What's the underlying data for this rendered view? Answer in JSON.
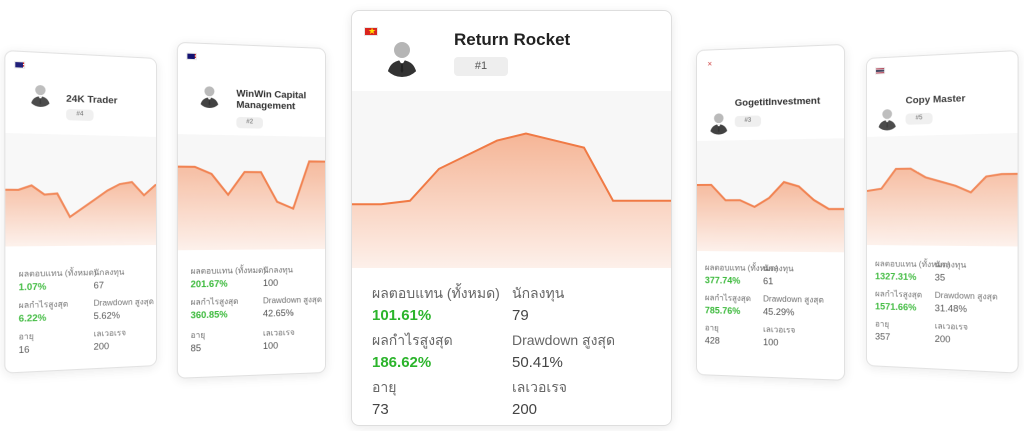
{
  "cards": [
    {
      "id": "l2",
      "name": "24K Trader",
      "rank": "#4",
      "flag": "malaysia-flag",
      "stats": {
        "return_label": "ผลตอบแทน (ทั้งหมด)",
        "return_value": "1.07%",
        "investors_label": "นักลงทุน",
        "investors_value": "67",
        "max_profit_label": "ผลกำไรสูงสุด",
        "max_profit_value": "6.22%",
        "drawdown_label": "Drawdown สูงสุด",
        "drawdown_value": "5.62%",
        "age_label": "อายุ",
        "age_value": "16",
        "leverage_label": "เลเวอเรจ",
        "leverage_value": "200"
      },
      "chart_data": {
        "type": "area",
        "values": [
          50,
          50,
          54,
          46,
          47,
          26,
          34,
          42,
          50,
          56,
          58,
          46,
          56
        ],
        "ylim": [
          0,
          100
        ]
      }
    },
    {
      "id": "l1",
      "name": "WinWin Capital Management",
      "rank": "#2",
      "flag": "malaysia-flag",
      "stats": {
        "return_label": "ผลตอบแทน (ทั้งหมด)",
        "return_value": "201.67%",
        "investors_label": "นักลงทุน",
        "investors_value": "100",
        "max_profit_label": "ผลกำไรสูงสุด",
        "max_profit_value": "360.85%",
        "drawdown_label": "Drawdown สูงสุด",
        "drawdown_value": "42.65%",
        "age_label": "อายุ",
        "age_value": "85",
        "leverage_label": "เลเวอเรจ",
        "leverage_value": "100"
      },
      "chart_data": {
        "type": "area",
        "values": [
          72,
          72,
          66,
          48,
          68,
          68,
          42,
          36,
          78,
          78
        ],
        "ylim": [
          0,
          100
        ]
      }
    },
    {
      "id": "center",
      "name": "Return Rocket",
      "rank": "#1",
      "flag": "vietnam-flag",
      "stats": {
        "return_label": "ผลตอบแทน (ทั้งหมด)",
        "return_value": "101.61%",
        "investors_label": "นักลงทุน",
        "investors_value": "79",
        "max_profit_label": "ผลกำไรสูงสุด",
        "max_profit_value": "186.62%",
        "drawdown_label": "Drawdown สูงสุด",
        "drawdown_value": "50.41%",
        "age_label": "อายุ",
        "age_value": "73",
        "leverage_label": "เลเวอเรจ",
        "leverage_value": "200"
      },
      "chart_data": {
        "type": "area",
        "values": [
          36,
          36,
          38,
          56,
          64,
          72,
          76,
          72,
          68,
          38,
          38,
          38
        ],
        "ylim": [
          0,
          100
        ]
      }
    },
    {
      "id": "r1",
      "name": "GogetitInvestment",
      "rank": "#3",
      "flag": "x-flag",
      "stats": {
        "return_label": "ผลตอบแทน (ทั้งหมด)",
        "return_value": "377.74%",
        "investors_label": "นักลงทุน",
        "investors_value": "61",
        "max_profit_label": "ผลกำไรสูงสุด",
        "max_profit_value": "785.76%",
        "drawdown_label": "Drawdown สูงสุด",
        "drawdown_value": "45.29%",
        "age_label": "อายุ",
        "age_value": "428",
        "leverage_label": "เลเวอเรจ",
        "leverage_value": "100"
      },
      "chart_data": {
        "type": "area",
        "values": [
          60,
          60,
          46,
          46,
          40,
          48,
          62,
          58,
          46,
          38,
          38
        ],
        "ylim": [
          0,
          100
        ]
      }
    },
    {
      "id": "r2",
      "name": "Copy Master",
      "rank": "#5",
      "flag": "thailand-flag",
      "stats": {
        "return_label": "ผลตอบแทน (ทั้งหมด)",
        "return_value": "1327.31%",
        "investors_label": "นักลงทุน",
        "investors_value": "35",
        "max_profit_label": "ผลกำไรสูงสุด",
        "max_profit_value": "1571.66%",
        "drawdown_label": "Drawdown สูงสุด",
        "drawdown_value": "31.48%",
        "age_label": "อายุ",
        "age_value": "357",
        "leverage_label": "เลเวอเรจ",
        "leverage_value": "200"
      },
      "chart_data": {
        "type": "area",
        "values": [
          50,
          52,
          70,
          70,
          62,
          58,
          54,
          48,
          62,
          64,
          64
        ],
        "ylim": [
          0,
          100
        ]
      }
    }
  ],
  "colors": {
    "chart_line": "#f07a45",
    "chart_fill": "#f5b596",
    "positive": "#2bb42b"
  }
}
